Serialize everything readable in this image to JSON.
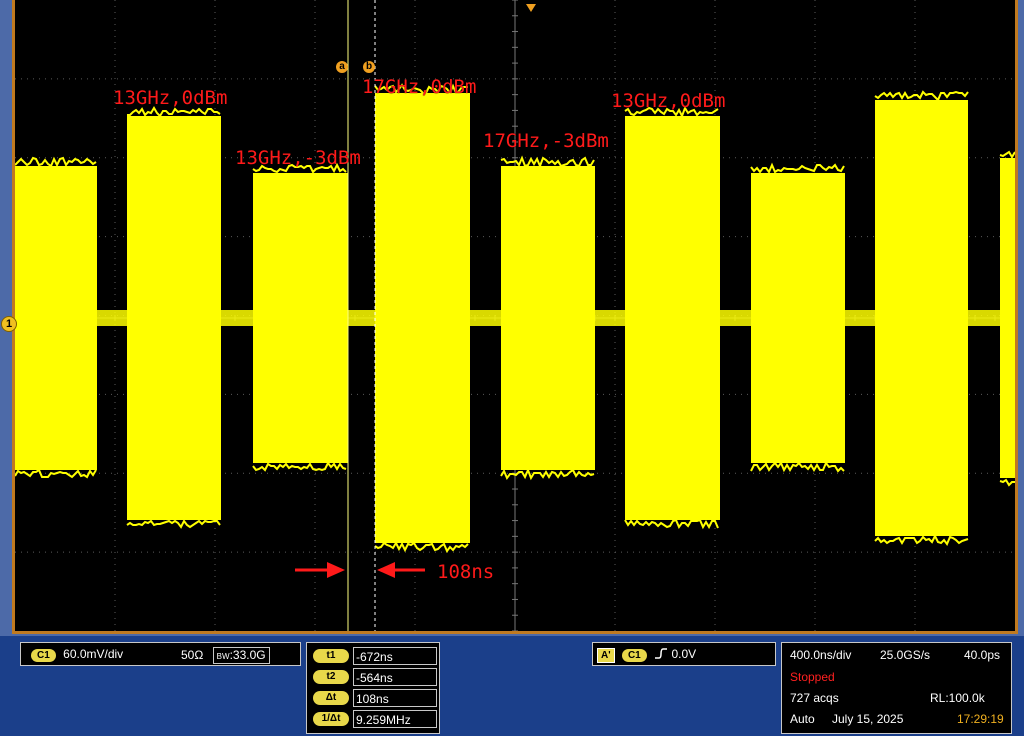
{
  "plot": {
    "cursor_a_label": "a",
    "cursor_b_label": "b",
    "channel_marker": "1",
    "annotations": [
      {
        "id": "ann-1",
        "text": "13GHz,0dBm"
      },
      {
        "id": "ann-2",
        "text": "13GHz,-3dBm"
      },
      {
        "id": "ann-3",
        "text": "17GHz,0dBm"
      },
      {
        "id": "ann-4",
        "text": "17GHz,-3dBm"
      },
      {
        "id": "ann-5",
        "text": "13GHz,0dBm"
      },
      {
        "id": "ann-6",
        "text": "108ns"
      }
    ],
    "trace_color": "#ffff00",
    "annotation_color": "#ff1a1a"
  },
  "channel": {
    "chip": "C1",
    "scale": "60.0mV/div",
    "impedance": "50Ω",
    "bw_prefix": "BW",
    "bandwidth": "33.0G"
  },
  "measurements": [
    {
      "label": "t1",
      "value": "-672ns"
    },
    {
      "label": "t2",
      "value": "-564ns"
    },
    {
      "label": "Δt",
      "value": "108ns"
    },
    {
      "label": "1/Δt",
      "value": "9.259MHz"
    }
  ],
  "trigger": {
    "mode_chip": "A'",
    "source_chip": "C1",
    "slope_icon": "rising-edge-icon",
    "level": "0.0V"
  },
  "acquisition": {
    "timebase": "400.0ns/div",
    "sample_rate": "25.0GS/s",
    "resolution": "40.0ps",
    "state": "Stopped",
    "acqs": "727 acqs",
    "record_length": "RL:100.0k",
    "mode": "Auto",
    "date": "July 15, 2025",
    "time": "17:29:19"
  }
}
